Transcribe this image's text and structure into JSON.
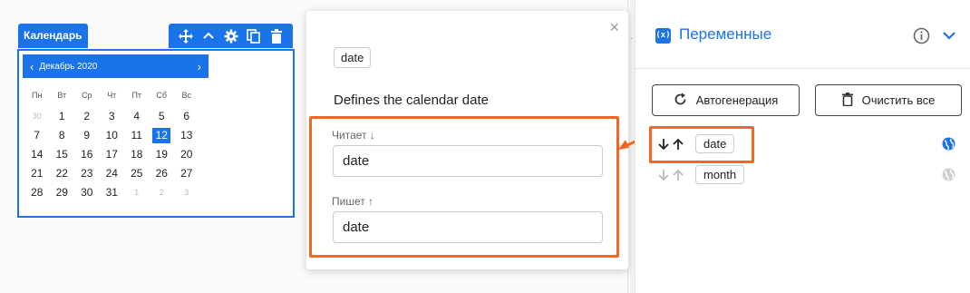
{
  "calendar_widget": {
    "label": "Календарь",
    "month_title": "Декабрь 2020",
    "prev": "‹",
    "next": "›",
    "weekdays": [
      "Пн",
      "Вт",
      "Ср",
      "Чт",
      "Пт",
      "Сб",
      "Вс"
    ],
    "days": [
      "30",
      "1",
      "2",
      "3",
      "4",
      "5",
      "6",
      "7",
      "8",
      "9",
      "10",
      "11",
      "12",
      "13",
      "14",
      "15",
      "16",
      "17",
      "18",
      "19",
      "20",
      "21",
      "22",
      "23",
      "24",
      "25",
      "26",
      "27",
      "28",
      "29",
      "30",
      "31",
      "1",
      "2",
      "3"
    ],
    "muted_days_index": [
      0,
      32,
      33,
      34
    ],
    "selected_day_index": 12
  },
  "popover": {
    "close": "×",
    "variable_chip": "date",
    "description": "Defines the calendar date",
    "reads_label": "Читает ↓",
    "reads_value": "date",
    "writes_label": "Пишет ↑",
    "writes_value": "date"
  },
  "variables_panel": {
    "icon_text": "(x)",
    "title": "Переменные",
    "auto_button": "Автогенерация",
    "clear_button": "Очистить все",
    "variables": [
      {
        "name": "date",
        "active": true
      },
      {
        "name": "month",
        "active": false
      }
    ]
  },
  "colors": {
    "accent": "#1a73e8",
    "highlight": "#f26522"
  }
}
